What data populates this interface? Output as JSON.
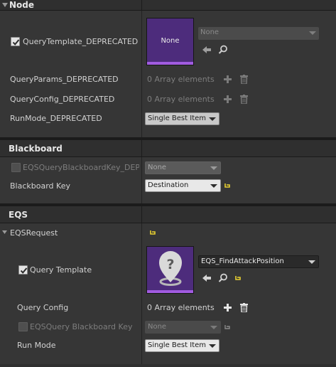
{
  "sections": {
    "node": "Node",
    "blackboard": "Blackboard",
    "eqs": "EQS"
  },
  "node": {
    "query_template": {
      "label": "QueryTemplate_DEPRECATED",
      "checked": true,
      "thumbnail_text": "None",
      "asset_value": "None"
    },
    "query_params": {
      "label": "QueryParams_DEPRECATED",
      "value": "0 Array elements"
    },
    "query_config": {
      "label": "QueryConfig_DEPRECATED",
      "value": "0 Array elements"
    },
    "run_mode": {
      "label": "RunMode_DEPRECATED",
      "value": "Single Best Item"
    }
  },
  "blackboard": {
    "eqs_key": {
      "label": "EQSQueryBlackboardKey_DEPRE",
      "value": "None",
      "checked": false
    },
    "blackboard_key": {
      "label": "Blackboard Key",
      "value": "Destination"
    }
  },
  "eqs": {
    "request_label": "EQSRequest",
    "query_template": {
      "label": "Query Template",
      "checked": true,
      "asset_value": "EQS_FindAttackPosition"
    },
    "query_config": {
      "label": "Query Config",
      "value": "0 Array elements"
    },
    "blackboard_key": {
      "label": "EQSQuery Blackboard Key",
      "value": "None",
      "checked": false
    },
    "run_mode": {
      "label": "Run Mode",
      "value": "Single Best Item"
    }
  },
  "colors": {
    "accent_purple": "#a15be0",
    "thumbnail_bg": "#4d2c7c",
    "reset_arrow_yellow": "#e8d030"
  },
  "icons": [
    "collapse-arrow-icon",
    "checkmark-icon",
    "use-selected-arrow-icon",
    "browse-magnifier-icon",
    "add-plus-icon",
    "delete-trash-icon",
    "reset-to-default-icon",
    "eqs-pin-thumbnail-icon"
  ]
}
